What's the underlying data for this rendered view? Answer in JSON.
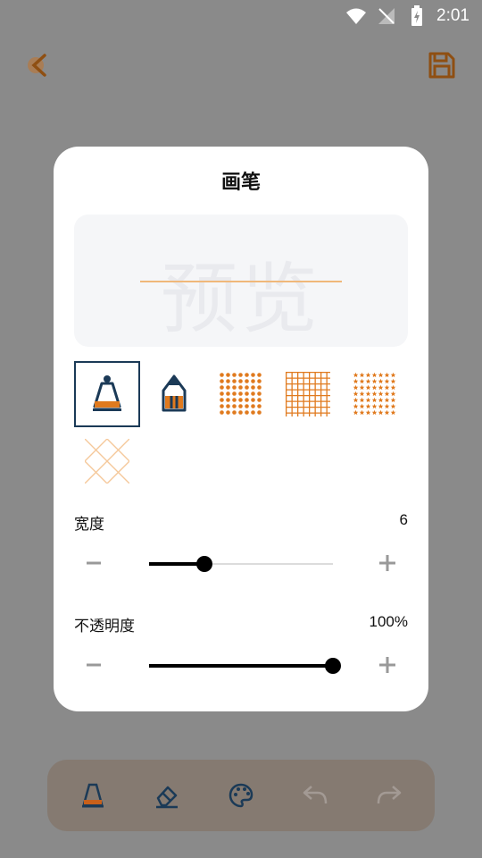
{
  "status_bar": {
    "time": "2:01"
  },
  "toolbar": {
    "back_icon": "chevron-left-icon",
    "save_icon": "save-icon"
  },
  "dialog": {
    "title": "画笔",
    "preview": {
      "watermark": "预览",
      "line_color": "#f0b87a"
    },
    "brushes": [
      {
        "name": "marker",
        "selected": true
      },
      {
        "name": "pencil",
        "selected": false
      },
      {
        "name": "dots-pattern",
        "selected": false
      },
      {
        "name": "grid-pattern",
        "selected": false
      },
      {
        "name": "stars-pattern",
        "selected": false
      },
      {
        "name": "crosshatch-pattern",
        "selected": false
      }
    ],
    "width": {
      "label": "宽度",
      "value": "6",
      "level": 0.3
    },
    "opacity": {
      "label": "不透明度",
      "value": "100%",
      "level": 1.0
    },
    "minus": "−",
    "plus": "+"
  },
  "bottom_bar": {
    "tools": [
      "marker-icon",
      "eraser-icon",
      "palette-icon",
      "undo-icon",
      "redo-icon"
    ]
  },
  "colors": {
    "accent": "#e07a1e",
    "navy": "#1b3a57",
    "overlay": "#8a8a8a"
  }
}
